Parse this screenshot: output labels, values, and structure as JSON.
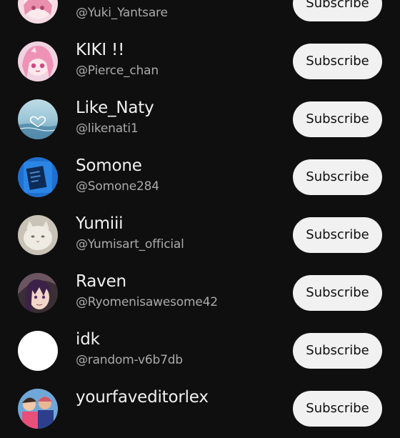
{
  "colors": {
    "background": "#0f0f0f",
    "name_text": "#f1f1f1",
    "handle_text": "#aaaaaa",
    "subscribe_bg": "#f1f1f1",
    "subscribe_text": "#0f0f0f"
  },
  "channels": [
    {
      "name": "",
      "handle": "@Yuki_Yantsare",
      "subscribe_label": "Subscribe",
      "avatar": "pink-anime-avatar"
    },
    {
      "name": "KIKI !!",
      "handle": "@Pierce_chan",
      "subscribe_label": "Subscribe",
      "avatar": "pink-hair-anime-avatar"
    },
    {
      "name": "Like_Naty",
      "handle": "@likenati1",
      "subscribe_label": "Subscribe",
      "avatar": "ocean-heart-avatar"
    },
    {
      "name": "Somone",
      "handle": "@Somone284",
      "subscribe_label": "Subscribe",
      "avatar": "blue-book-avatar"
    },
    {
      "name": "Yumiii",
      "handle": "@Yumisart_official",
      "subscribe_label": "Subscribe",
      "avatar": "white-cat-avatar"
    },
    {
      "name": "Raven",
      "handle": "@Ryomenisawesome42",
      "subscribe_label": "Subscribe",
      "avatar": "purple-hair-anime-avatar"
    },
    {
      "name": "idk",
      "handle": "@random-v6b7db",
      "subscribe_label": "Subscribe",
      "avatar": "blank-white-avatar"
    },
    {
      "name": "yourfaveditorlex",
      "handle": "",
      "subscribe_label": "Subscribe",
      "avatar": "colorful-group-avatar"
    }
  ]
}
